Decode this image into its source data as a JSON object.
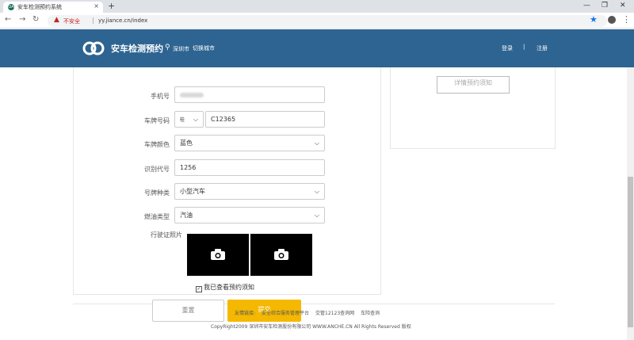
{
  "browser": {
    "tab_title": "安车检测预约系统",
    "favicon_text": "OA",
    "new_tab": "+",
    "security_label": "不安全",
    "url": "yy.jiance.cn/index"
  },
  "header": {
    "brand": "安车检测预约",
    "city": "深圳市",
    "switch_city": "切换城市",
    "login": "登录",
    "separator": "|",
    "register": "注册",
    "bg_color": "#2e6491"
  },
  "side": {
    "detail_button": "详情预约须知"
  },
  "form": {
    "phone_label": "手机号",
    "plate_label": "车牌号码",
    "plate_prefix": "桂",
    "plate_value": "C12365",
    "plate_color_label": "车牌颜色",
    "plate_color_value": "蓝色",
    "vin_label": "识别代号",
    "vin_value": "1256",
    "plate_type_label": "号牌种类",
    "plate_type_value": "小型汽车",
    "fuel_label": "燃油类型",
    "fuel_value": "汽油",
    "license_photo_label": "行驶证照片",
    "agree_label": "我已查看预约须知",
    "reset_button": "重置",
    "submit_button": "提交",
    "accent_color": "#f5b800"
  },
  "footer": {
    "links_prefix": "友情链接:",
    "link1": "安全综合服务管理平台",
    "link2": "交管12123查询网",
    "link3": "车险查询",
    "copyright": "CopyRight2009 深圳市安车检测股份有限公司 WWW.ANCHE.CN All Rights Reserved 版权"
  }
}
